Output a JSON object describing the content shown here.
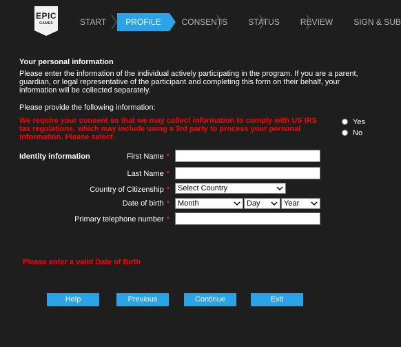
{
  "logo": {
    "line1": "EPIC",
    "line2": "GAMES"
  },
  "steps": [
    "START",
    "PROFILE",
    "CONSENTS",
    "STATUS",
    "REVIEW",
    "SIGN & SUBMIT"
  ],
  "section_title": "Your personal information",
  "intro": "Please enter the information of the individual actively participating in the program.  If you are a parent, guardian, or legal representative of the participant and completing this form on their behalf, your information will be collected separately.",
  "provide_text": "Please provide the following information:",
  "consent_text": "We require your consent so that we may collect information to comply with US IRS tax regulations, which may include using a 3rd party to process your personal information. Please select:",
  "consent_options": [
    "Yes",
    "No"
  ],
  "identity_heading": "Identity information",
  "fields": {
    "first_name": "First Name",
    "last_name": "Last Name",
    "citizenship": "Country of Citizenship",
    "dob": "Date of birth",
    "phone": "Primary telephone number"
  },
  "required_mark": "*",
  "selects": {
    "country": "Select Country",
    "month": "Month",
    "day": "Day",
    "year": "Year"
  },
  "error": "Please enter a valid Date of Birth",
  "buttons": {
    "help": "Help",
    "previous": "Previous",
    "continue": "Continue",
    "exit": "Exit"
  },
  "colors": {
    "accent": "#2aa3e8",
    "background": "#1e1e1e",
    "error": "#ff0000"
  }
}
